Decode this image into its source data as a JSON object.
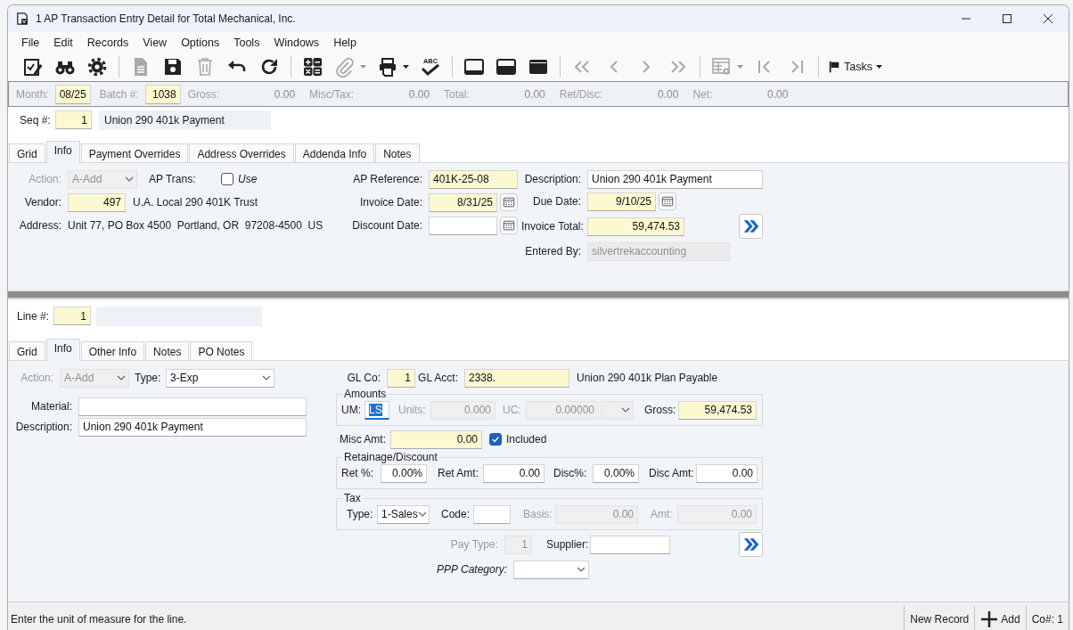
{
  "window": {
    "title": "1 AP Transaction Entry Detail for Total Mechanical, Inc."
  },
  "menu": [
    "File",
    "Edit",
    "Records",
    "View",
    "Options",
    "Tools",
    "Windows",
    "Help"
  ],
  "toolbar": {
    "groups": [
      [
        {
          "kind": "edit",
          "disabled": false
        },
        {
          "kind": "find",
          "disabled": false
        },
        {
          "kind": "settings",
          "disabled": false
        }
      ],
      [
        {
          "kind": "document",
          "disabled": true
        },
        {
          "kind": "save",
          "disabled": false
        },
        {
          "kind": "delete",
          "disabled": true
        },
        {
          "kind": "undo",
          "disabled": false
        },
        {
          "kind": "redo",
          "disabled": false
        }
      ],
      [
        {
          "kind": "calculator",
          "disabled": false
        },
        {
          "kind": "attach",
          "disabled": true,
          "dropdown": true
        },
        {
          "kind": "print",
          "disabled": false,
          "dropdown": true
        },
        {
          "kind": "spellcheck",
          "disabled": false,
          "label": "ABC"
        }
      ],
      [
        {
          "kind": "layout-bottom",
          "disabled": false
        },
        {
          "kind": "layout-middle",
          "disabled": false
        },
        {
          "kind": "layout-top",
          "disabled": false
        }
      ],
      [
        {
          "kind": "first",
          "disabled": true
        },
        {
          "kind": "previous",
          "disabled": true
        },
        {
          "kind": "next",
          "disabled": true
        },
        {
          "kind": "last",
          "disabled": true
        }
      ],
      [
        {
          "kind": "grid-settings",
          "disabled": true,
          "dropdown": true
        },
        {
          "kind": "first-record",
          "disabled": true
        },
        {
          "kind": "last-record",
          "disabled": true
        }
      ]
    ],
    "tasks": {
      "label": "Tasks"
    }
  },
  "summary": [
    {
      "label": "Month:",
      "value": "08/25",
      "kind": "text"
    },
    {
      "label": "Batch #:",
      "value": "1038",
      "kind": "text"
    },
    {
      "label": "Gross:",
      "value": "0.00",
      "kind": "display"
    },
    {
      "label": "Misc/Tax:",
      "value": "0.00",
      "kind": "display"
    },
    {
      "label": "Total:",
      "value": "0.00",
      "kind": "display"
    },
    {
      "label": "Ret/Disc:",
      "value": "0.00",
      "kind": "display"
    },
    {
      "label": "Net:",
      "value": "0.00",
      "kind": "display"
    }
  ],
  "header": {
    "seq": {
      "label": "Seq #:",
      "value": "1",
      "kind": "number",
      "required": true,
      "description": "Union 290 401k Payment"
    },
    "tabs": [
      {
        "label": "Grid",
        "selected": false
      },
      {
        "label": "Info",
        "selected": true
      },
      {
        "label": "Payment Overrides",
        "selected": false
      },
      {
        "label": "Address Overrides",
        "selected": false
      },
      {
        "label": "Addenda Info",
        "selected": false
      },
      {
        "label": "Notes",
        "selected": false
      }
    ],
    "info": {
      "action": {
        "label": "Action:",
        "value": "A-Add",
        "kind": "select",
        "disabled": true
      },
      "ap_trans": {
        "label": "AP Trans:",
        "kind": "check",
        "checked": false,
        "caption": "Use"
      },
      "vendor": {
        "label": "Vendor:",
        "value": "497",
        "kind": "number",
        "required": true,
        "note": "U.A. Local 290 401K Trust"
      },
      "address": {
        "label": "Address:",
        "value": "Unit 77, PO Box 4500  Portland, OR  97208-4500  US",
        "kind": "display"
      },
      "ap_reference": {
        "label": "AP Reference:",
        "value": "401K-25-08",
        "kind": "text",
        "required": true
      },
      "invoice_date": {
        "label": "Invoice Date:",
        "value": "8/31/25",
        "kind": "date",
        "required": true
      },
      "discount_date": {
        "label": "Discount Date:",
        "kind": "date"
      },
      "description": {
        "label": "Description:",
        "value": "Union 290 401k Payment",
        "kind": "text"
      },
      "due_date": {
        "label": "Due Date:",
        "value": "9/10/25",
        "kind": "date",
        "required": true
      },
      "invoice_total": {
        "label": "Invoice Total:",
        "value": "59,474.53",
        "kind": "number",
        "required": true
      },
      "entered_by": {
        "label": "Entered By:",
        "value": "silvertrekaccounting",
        "kind": "text",
        "read_only": true
      }
    }
  },
  "line": {
    "line_no": {
      "label": "Line #:",
      "value": "1",
      "kind": "number",
      "required": true
    },
    "tabs": [
      {
        "label": "Grid",
        "selected": false
      },
      {
        "label": "Info",
        "selected": true
      },
      {
        "label": "Other Info",
        "selected": false
      },
      {
        "label": "Notes",
        "selected": false
      },
      {
        "label": "PO Notes",
        "selected": false
      }
    ],
    "info": {
      "action": {
        "label": "Action:",
        "value": "A-Add",
        "kind": "select",
        "disabled": true
      },
      "type": {
        "label": "Type:",
        "value": "3-Exp",
        "kind": "select"
      },
      "material": {
        "label": "Material:",
        "kind": "text"
      },
      "description": {
        "label": "Description:",
        "value": "Union 290 401k Payment",
        "kind": "text"
      },
      "gl_co": {
        "label": "GL Co:",
        "value": "1",
        "kind": "number",
        "required": true
      },
      "gl_acct": {
        "label": "GL Acct:",
        "value": "2338.",
        "kind": "text",
        "required": true,
        "note": "Union 290 401k Plan Payable"
      },
      "amounts": {
        "title": "Amounts",
        "fields": [
          {
            "label": "UM:",
            "value": "LS",
            "kind": "text",
            "required": false,
            "disabled": false,
            "focused": true
          },
          {
            "label": "Units:",
            "value": "0.000",
            "kind": "number",
            "required": false,
            "disabled": true,
            "focused": false
          },
          {
            "label": "UC:",
            "value": "0.00000",
            "kind": "number",
            "required": false,
            "disabled": true,
            "focused": false
          },
          {
            "kind": "select",
            "required": false,
            "disabled": true,
            "focused": false
          },
          {
            "label": "Gross:",
            "value": "59,474.53",
            "kind": "number",
            "required": true,
            "disabled": false,
            "focused": false
          }
        ]
      },
      "misc_amt": {
        "label": "Misc Amt:",
        "value": "0.00",
        "kind": "number",
        "required": true
      },
      "included": {
        "kind": "check",
        "checked": true,
        "caption": "Included"
      },
      "retainage": {
        "title": "Retainage/Discount",
        "fields": [
          {
            "label": "Ret %:",
            "value": "0.00%",
            "kind": "number",
            "required": false,
            "disabled": false
          },
          {
            "label": "Ret Amt:",
            "value": "0.00",
            "kind": "number",
            "required": false,
            "disabled": false
          },
          {
            "label": "Disc%:",
            "value": "0.00%",
            "kind": "number",
            "required": false,
            "disabled": false
          },
          {
            "label": "Disc Amt:",
            "value": "0.00",
            "kind": "number",
            "required": false,
            "disabled": false
          }
        ]
      },
      "tax": {
        "title": "Tax",
        "fields": [
          {
            "label": "Type:",
            "value": "1-Sales",
            "kind": "select",
            "required": false,
            "disabled": false
          },
          {
            "label": "Code:",
            "kind": "text",
            "required": false,
            "disabled": false
          },
          {
            "label": "Basis:",
            "value": "0.00",
            "kind": "number",
            "required": false,
            "disabled": true
          },
          {
            "label": "Amt:",
            "value": "0.00",
            "kind": "number",
            "required": false,
            "disabled": true
          }
        ]
      },
      "pay_type": {
        "label": "Pay Type:",
        "value": "1",
        "kind": "number",
        "disabled": true
      },
      "supplier": {
        "label": "Supplier:",
        "kind": "text"
      },
      "ppp_category": {
        "label": "PPP Category:",
        "kind": "select"
      }
    }
  },
  "status_bar": {
    "message": "Enter the unit of measure for the line.",
    "items": [
      {
        "label": "New Record",
        "kind": "text"
      },
      {
        "label": "Add",
        "kind": "add"
      },
      {
        "label": "Co#: 1",
        "kind": "text"
      }
    ]
  }
}
